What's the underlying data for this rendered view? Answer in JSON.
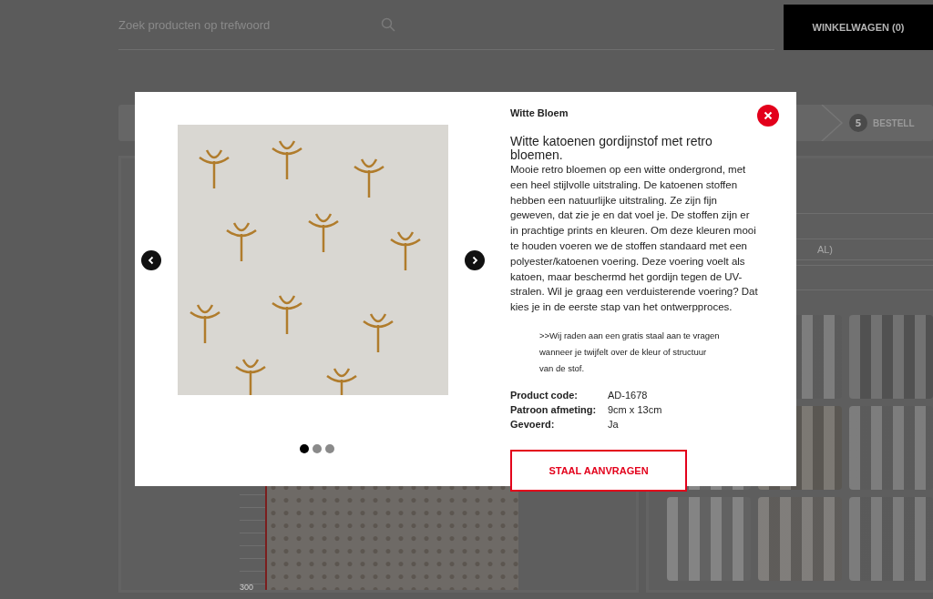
{
  "search": {
    "placeholder": "Zoek producten op trefwoord"
  },
  "cart_button": "WINKELWAGEN (0)",
  "steps": [
    {
      "number": "5",
      "label": "BESTELL"
    }
  ],
  "form": {
    "field_value": "AL)"
  },
  "preview": {
    "ruler_label": "300"
  },
  "modal": {
    "title": "Witte Bloem",
    "heading": "Witte katoenen gordijnstof met retro bloemen.",
    "description": "Mooie retro bloemen op een witte ondergrond, met een heel stijlvolle uitstraling. De katoenen stoffen hebben een natuurlijke uitstraling. Ze zijn fijn geweven, dat zie je en dat voel je. De stoffen zijn er in prachtige prints en kleuren. Om deze kleuren mooi te houden voeren we de stoffen standaard met een polyester/katoenen voering. Deze voering voelt als katoen, maar beschermd het gordijn tegen de UV-stralen. Wil je graag een verduisterende voering? Dat kies je in de eerste stap van het ontwerpproces.",
    "note": ">>Wij raden aan een gratis staal aan te vragen wanneer je twijfelt over de kleur of structuur van de stof.",
    "specs": [
      {
        "label": "Product code:",
        "value": "AD-1678"
      },
      {
        "label": "Patroon afmeting:",
        "value": "9cm x 13cm"
      },
      {
        "label": "Gevoerd:",
        "value": "Ja"
      }
    ],
    "button": "STAAL AANVRAGEN",
    "slides": [
      {
        "selected": true
      },
      {
        "selected": false
      },
      {
        "selected": false
      }
    ]
  }
}
